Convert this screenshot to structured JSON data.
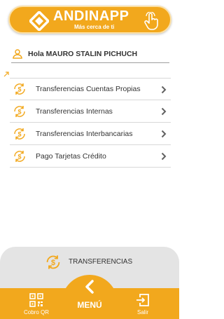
{
  "header": {
    "brand_name": "ANDINAPP",
    "slogan": "Más cerca de ti"
  },
  "greeting": {
    "text": "Hola MAURO STALIN PICHUCH"
  },
  "menu": {
    "items": [
      {
        "label": "Transferencias Cuentas Propias"
      },
      {
        "label": "Transferencias Internas"
      },
      {
        "label": "Transferencias Interbancarias"
      },
      {
        "label": "Pago Tarjetas Crédito"
      }
    ]
  },
  "section": {
    "label": "TRANSFERENCIAS"
  },
  "nav": {
    "qr_label": "Cobro QR",
    "menu_label": "MENÚ",
    "exit_label": "Salir"
  },
  "colors": {
    "accent": "#f2a81d",
    "chevron": "#616161",
    "text": "#333333"
  }
}
